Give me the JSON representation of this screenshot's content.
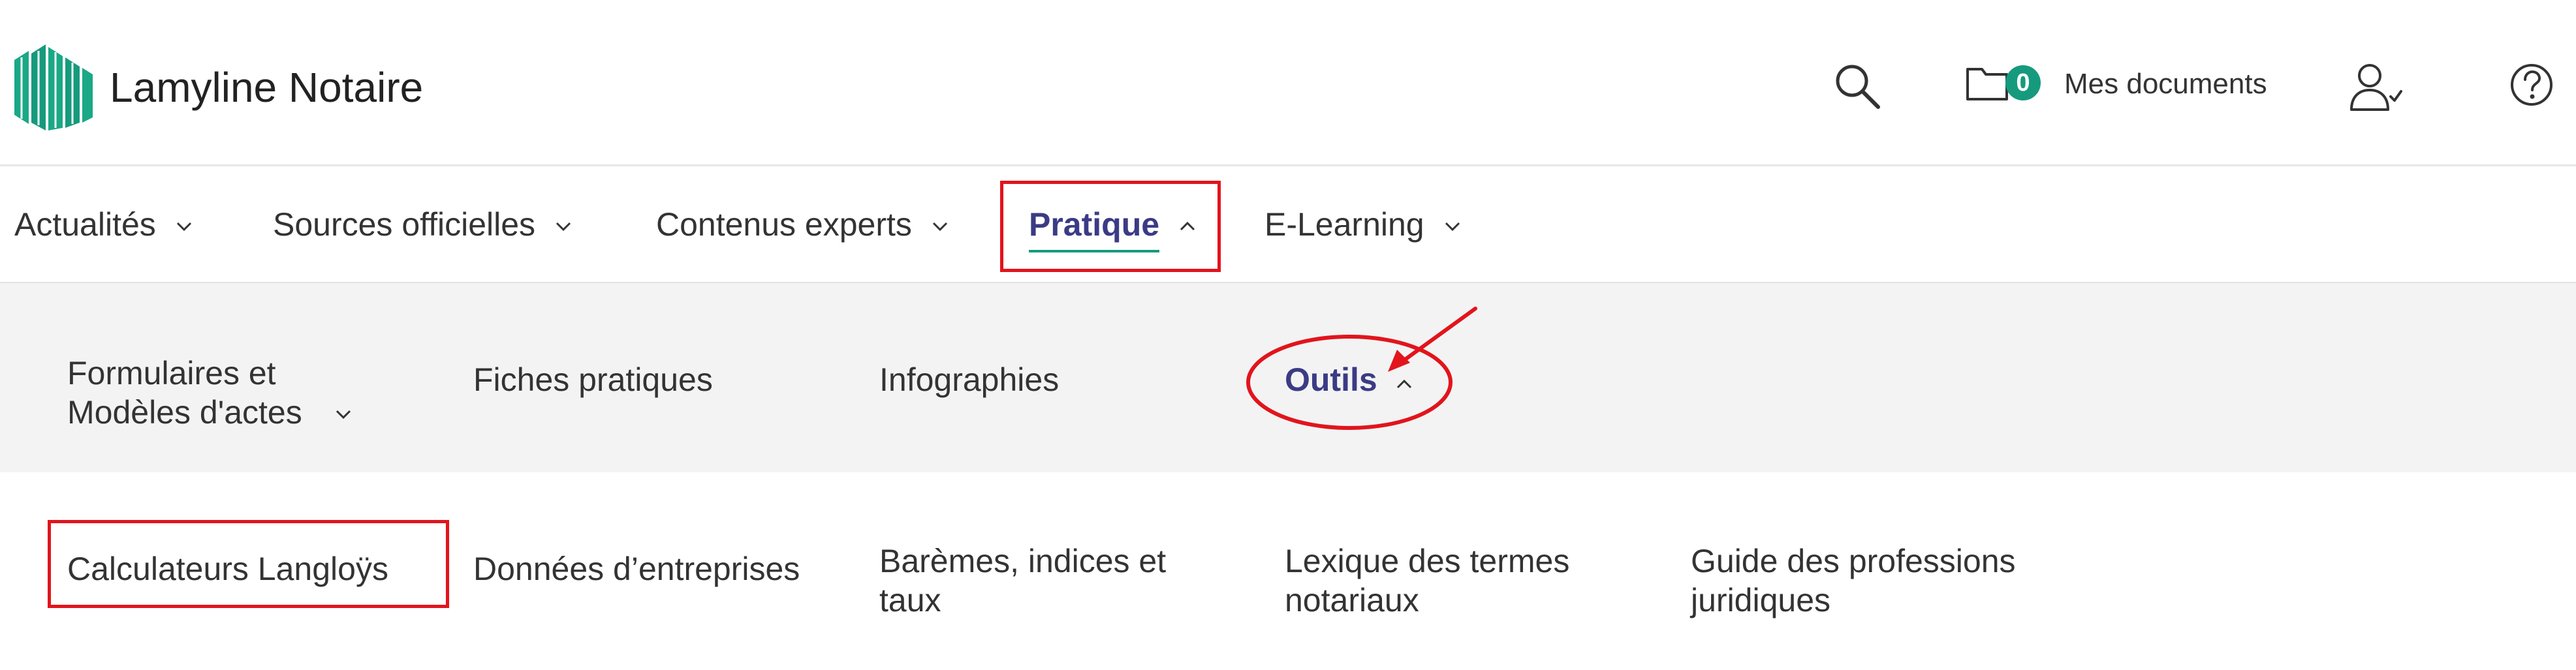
{
  "brand": {
    "name": "Lamyline Notaire",
    "color": "#169a7d"
  },
  "header": {
    "search_icon": "search-icon",
    "documents": {
      "count": "0",
      "label": "Mes documents"
    },
    "user_icon": "user-check-icon",
    "help_icon": "help-circle-icon"
  },
  "mainnav": {
    "items": [
      {
        "label": "Actualités",
        "expanded": false
      },
      {
        "label": "Sources officielles",
        "expanded": false
      },
      {
        "label": "Contenus experts",
        "expanded": false
      },
      {
        "label": "Pratique",
        "expanded": true,
        "active": true
      },
      {
        "label": "E-Learning",
        "expanded": false
      }
    ]
  },
  "subnav": {
    "items": [
      {
        "label": "Formulaires et\nModèles d'actes",
        "expanded": false
      },
      {
        "label": "Fiches pratiques"
      },
      {
        "label": "Infographies"
      },
      {
        "label": "Outils",
        "expanded": true,
        "active": true
      }
    ]
  },
  "tools": {
    "items": [
      {
        "label": "Calculateurs Langloÿs"
      },
      {
        "label": "Données d’entreprises"
      },
      {
        "label": "Barèmes, indices et\ntaux"
      },
      {
        "label": "Lexique des termes\nnotariaux"
      },
      {
        "label": "Guide des professions\njuridiques"
      }
    ]
  },
  "colors": {
    "accent": "#169a7d",
    "active_text": "#3b3b85",
    "annotation": "#e2141c",
    "subnav_bg": "#f3f3f3"
  }
}
